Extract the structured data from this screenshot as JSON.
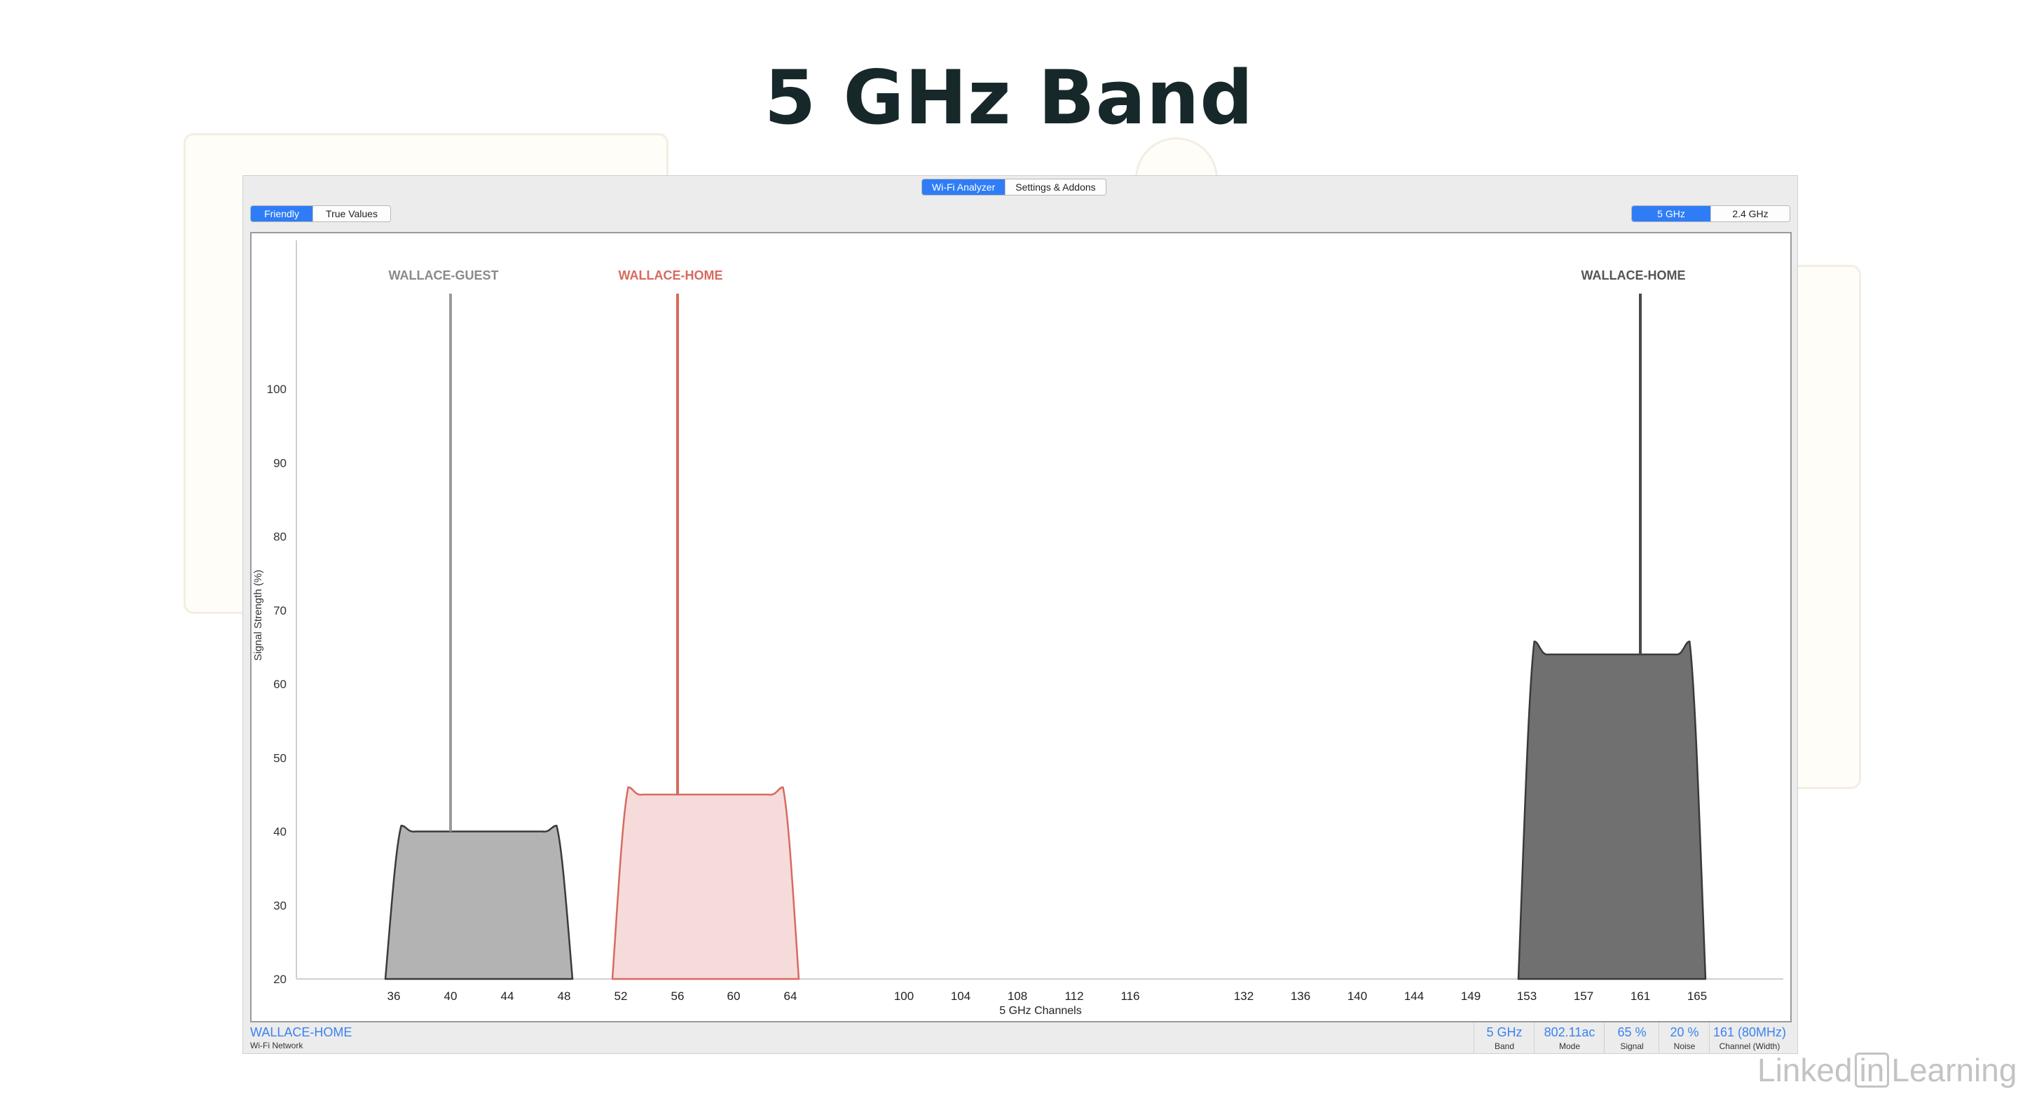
{
  "slide": {
    "title": "5 GHz Band"
  },
  "toolbar": {
    "tabs": [
      {
        "label": "Wi-Fi Analyzer",
        "active": true
      },
      {
        "label": "Settings & Addons",
        "active": false
      }
    ],
    "view_modes": [
      {
        "label": "Friendly",
        "active": true
      },
      {
        "label": "True Values",
        "active": false
      }
    ],
    "bands": [
      {
        "label": "5 GHz",
        "active": true
      },
      {
        "label": "2.4 GHz",
        "active": false
      }
    ]
  },
  "chart_data": {
    "type": "area",
    "title": "",
    "xlabel": "5 GHz Channels",
    "ylabel": "Signal Strength (%)",
    "ylim": [
      20,
      100
    ],
    "yticks": [
      20,
      30,
      40,
      50,
      60,
      70,
      80,
      90,
      100
    ],
    "x_ticks": [
      "36",
      "40",
      "44",
      "48",
      "52",
      "56",
      "60",
      "64",
      "100",
      "104",
      "108",
      "112",
      "116",
      "132",
      "136",
      "140",
      "144",
      "149",
      "153",
      "157",
      "161",
      "165"
    ],
    "grid": false,
    "series": [
      {
        "name": "WALLACE-GUEST",
        "channel_start": 36,
        "channel_end": 48,
        "center_channel": 40,
        "value": 40,
        "color": "#b3b3b3",
        "line_color": "#9a9a9a",
        "label_color": "#8a8a8a"
      },
      {
        "name": "WALLACE-HOME",
        "channel_start": 52,
        "channel_end": 64,
        "center_channel": 56,
        "value": 45,
        "color": "#f5dcdb",
        "line_color": "#d9695f",
        "label_color": "#d9695f"
      },
      {
        "name": "WALLACE-HOME",
        "channel_start": 153,
        "channel_end": 165,
        "center_channel": 161,
        "value": 64,
        "color": "#707070",
        "line_color": "#4a4a4a",
        "label_color": "#555555"
      }
    ]
  },
  "status": {
    "network": "WALLACE-HOME",
    "network_caption": "Wi-Fi Network",
    "stats": [
      {
        "value": "5 GHz",
        "caption": "Band"
      },
      {
        "value": "802.11ac",
        "caption": "Mode"
      },
      {
        "value": "65 %",
        "caption": "Signal"
      },
      {
        "value": "20 %",
        "caption": "Noise"
      },
      {
        "value": "161 (80MHz)",
        "caption": "Channel (Width)"
      }
    ]
  },
  "watermark": {
    "part1": "Linked",
    "part2": "in",
    "part3": "Learning"
  },
  "colors": {
    "accent": "#2f7df6",
    "title": "#16282a"
  }
}
